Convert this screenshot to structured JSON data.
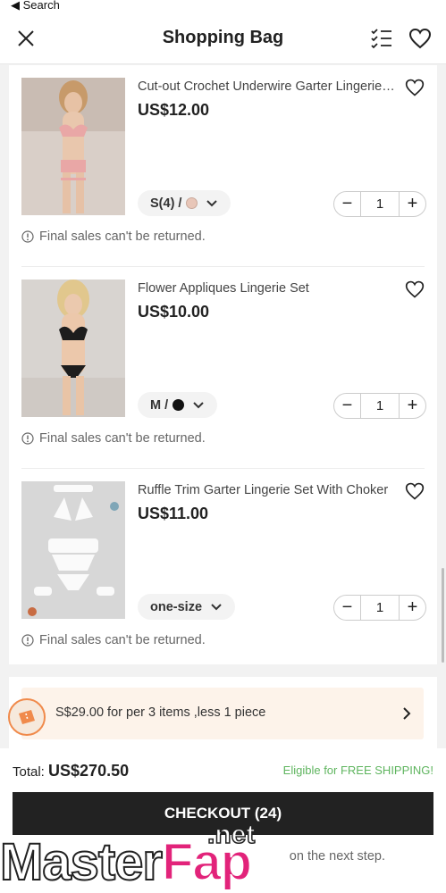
{
  "status_bar": {
    "back_label": "◀ Search"
  },
  "header": {
    "title": "Shopping Bag"
  },
  "items": [
    {
      "name": "Cut-out Crochet Underwire Garter Lingerie Set",
      "price": "US$12.00",
      "variant": "S(4) /",
      "swatch_color": "#e8c6b8",
      "quantity": "1",
      "notice": "Final sales can't be returned."
    },
    {
      "name": "Flower Appliques Lingerie Set",
      "price": "US$10.00",
      "variant": "M /",
      "swatch_color": "#111111",
      "quantity": "1",
      "notice": "Final sales can't be returned."
    },
    {
      "name": "Ruffle Trim Garter Lingerie Set With Choker",
      "price": "US$11.00",
      "variant": "one-size",
      "swatch_color": "",
      "quantity": "1",
      "notice": "Final sales can't be returned."
    }
  ],
  "promo": {
    "text": "S$29.00 for per 3 items ,less 1 piece"
  },
  "footer": {
    "total_label": "Total:",
    "total_amount": "US$270.50",
    "shipping": "Eligible for FREE SHIPPING!",
    "checkout_label": "CHECKOUT (24)",
    "next_step": "on the next step."
  },
  "watermark": {
    "main_a": "Master",
    "main_b": "Fap",
    "net": ".net"
  },
  "colors": {
    "accent_green": "#5fb55f",
    "checkout_bg": "#222222",
    "promo_bg": "#fdf3ea",
    "promo_badge": "#f08a4b"
  }
}
